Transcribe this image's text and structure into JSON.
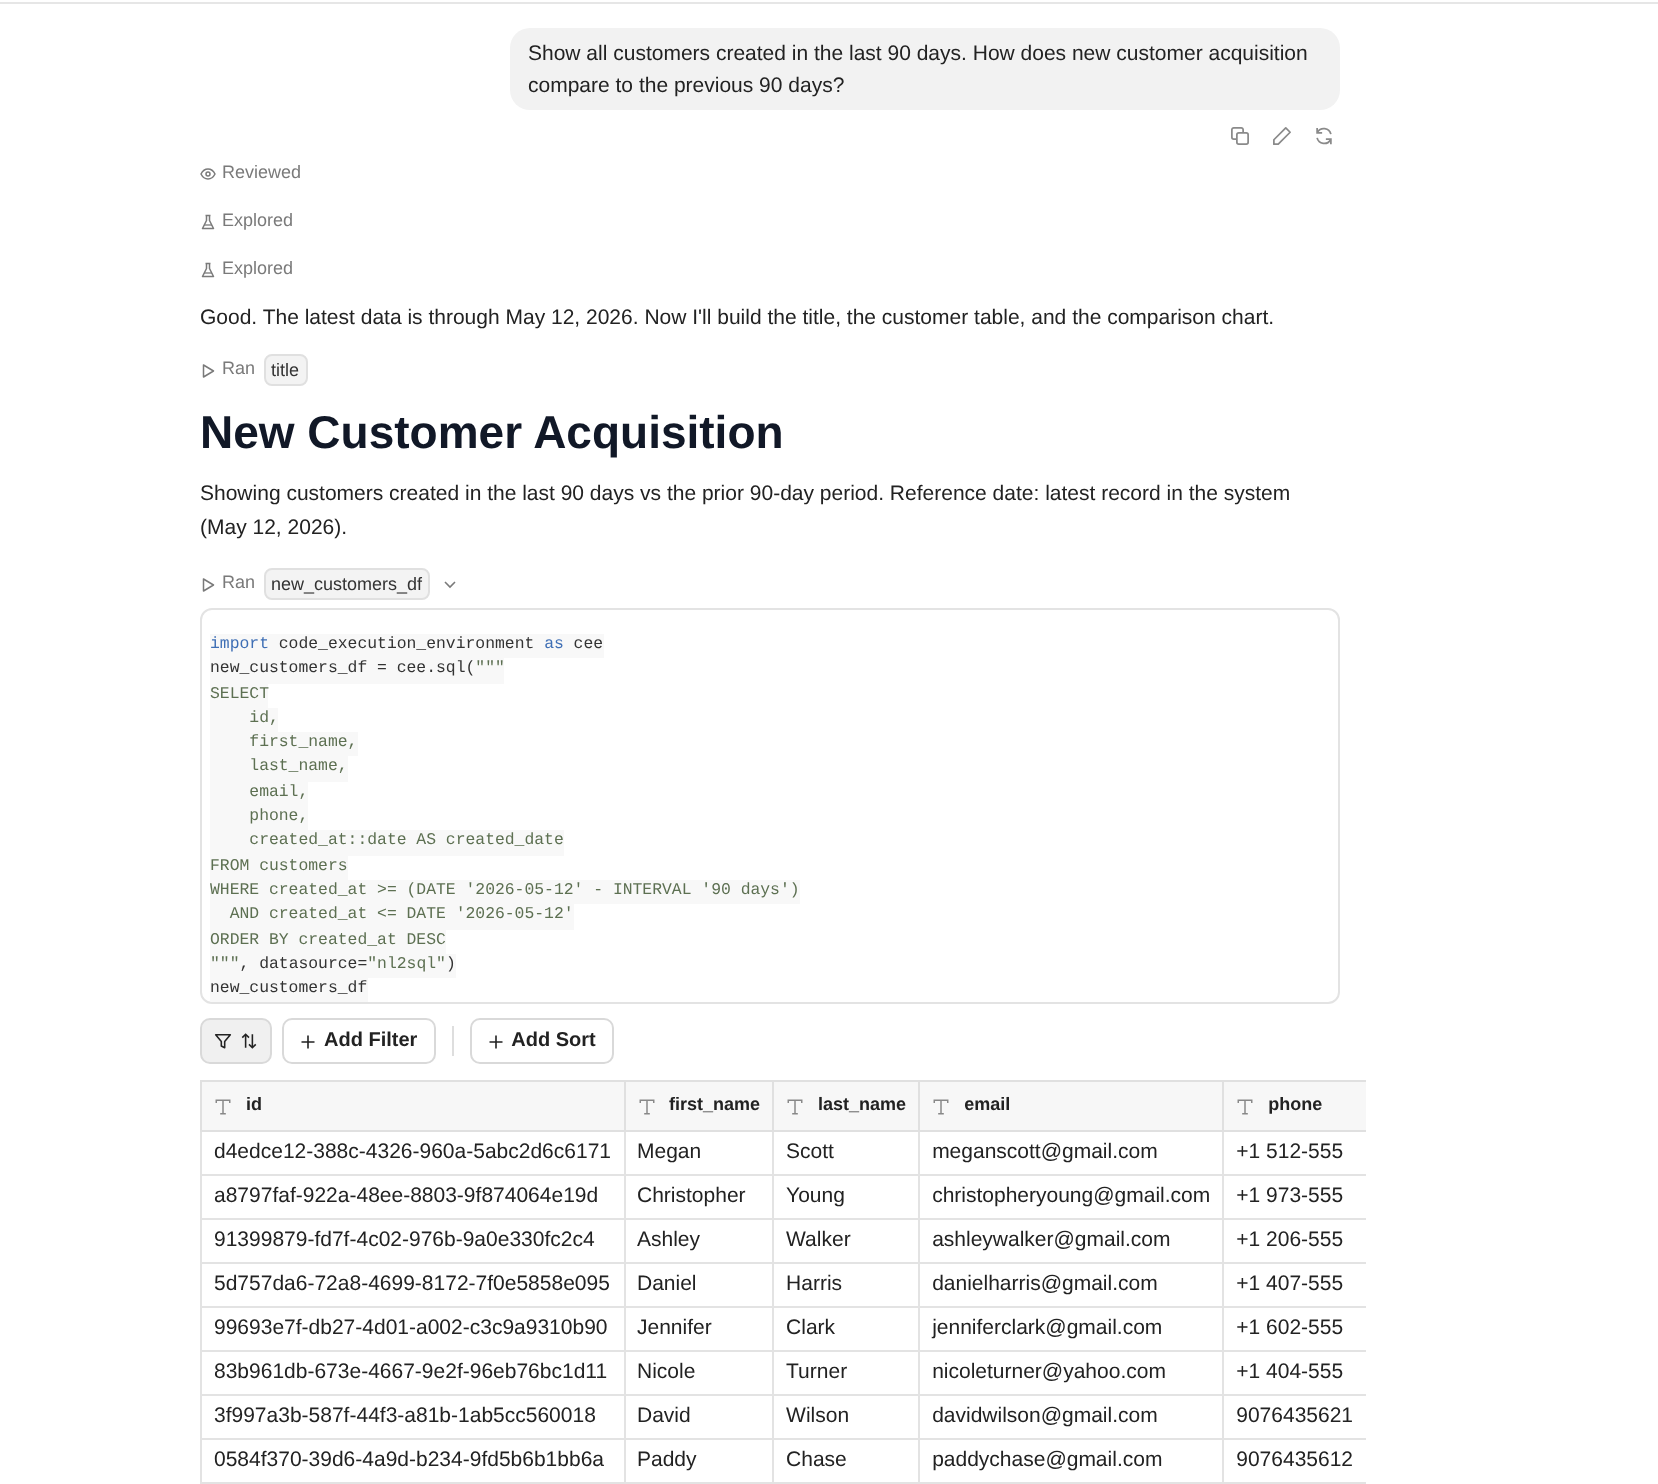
{
  "user_message": {
    "text": "Show all customers created in the last 90 days. How does new customer acquisition compare to the previous 90 days?"
  },
  "steps": [
    {
      "kind": "reviewed",
      "label": "Reviewed"
    },
    {
      "kind": "explored",
      "label": "Explored"
    },
    {
      "kind": "explored",
      "label": "Explored"
    }
  ],
  "assistant_message": "Good. The latest data is through May 12, 2026. Now I'll build the title, the customer table, and the comparison chart.",
  "run_title": {
    "label": "Ran",
    "chip": "title"
  },
  "title": "New Customer Acquisition",
  "description": "Showing customers created in the last 90 days vs the prior 90-day period. Reference date: latest record in the system (May 12, 2026).",
  "run_query": {
    "label": "Ran",
    "chip": "new_customers_df",
    "expanded": true,
    "code": [
      [
        {
          "kind": "keyword",
          "text": "import"
        },
        {
          "kind": "plain",
          "text": " code_execution_environment "
        },
        {
          "kind": "keyword",
          "text": "as"
        },
        {
          "kind": "plain",
          "text": " cee"
        }
      ],
      [
        {
          "kind": "plain",
          "text": "new_customers_df = cee.sql("
        },
        {
          "kind": "string",
          "text": "\"\"\""
        }
      ],
      [
        {
          "kind": "string",
          "text": "SELECT"
        }
      ],
      [
        {
          "kind": "string",
          "text": "    id,"
        }
      ],
      [
        {
          "kind": "string",
          "text": "    first_name,"
        }
      ],
      [
        {
          "kind": "string",
          "text": "    last_name,"
        }
      ],
      [
        {
          "kind": "string",
          "text": "    email,"
        }
      ],
      [
        {
          "kind": "string",
          "text": "    phone,"
        }
      ],
      [
        {
          "kind": "string",
          "text": "    created_at::date AS created_date"
        }
      ],
      [
        {
          "kind": "string",
          "text": "FROM customers"
        }
      ],
      [
        {
          "kind": "string",
          "text": "WHERE created_at >= (DATE '2026-05-12' - INTERVAL '90 days')"
        }
      ],
      [
        {
          "kind": "string",
          "text": "  AND created_at <= DATE '2026-05-12'"
        }
      ],
      [
        {
          "kind": "string",
          "text": "ORDER BY created_at DESC"
        }
      ],
      [
        {
          "kind": "string",
          "text": "\"\"\""
        },
        {
          "kind": "plain",
          "text": ", datasource="
        },
        {
          "kind": "string",
          "text": "\"nl2sql\""
        },
        {
          "kind": "plain",
          "text": ")"
        }
      ],
      [
        {
          "kind": "plain",
          "text": "new_customers_df"
        }
      ]
    ]
  },
  "table": {
    "toolbar": [
      {
        "kind": "filter_sort"
      },
      {
        "kind": "add",
        "label": "Add Filter"
      },
      {
        "kind": "add",
        "label": "Add Sort"
      }
    ],
    "columns": [
      {
        "kind": "text",
        "label": "id"
      },
      {
        "kind": "text",
        "label": "first_name"
      },
      {
        "kind": "text",
        "label": "last_name"
      },
      {
        "kind": "text",
        "label": "email"
      },
      {
        "kind": "text",
        "label": "phone"
      }
    ],
    "rows": [
      [
        "d4edce12-388c-4326-960a-5abc2d6c6171",
        "Megan",
        "Scott",
        "meganscott@gmail.com",
        "+1 512-555"
      ],
      [
        "a8797faf-922a-48ee-8803-9f874064e19d",
        "Christopher",
        "Young",
        "christopheryoung@gmail.com",
        "+1 973-555"
      ],
      [
        "91399879-fd7f-4c02-976b-9a0e330fc2c4",
        "Ashley",
        "Walker",
        "ashleywalker@gmail.com",
        "+1 206-555"
      ],
      [
        "5d757da6-72a8-4699-8172-7f0e5858e095",
        "Daniel",
        "Harris",
        "danielharris@gmail.com",
        "+1 407-555"
      ],
      [
        "99693e7f-db27-4d01-a002-c3c9a9310b90",
        "Jennifer",
        "Clark",
        "jenniferclark@gmail.com",
        "+1 602-555"
      ],
      [
        "83b961db-673e-4667-9e2f-96eb76bc1d11",
        "Nicole",
        "Turner",
        "nicoleturner@yahoo.com",
        "+1 404-555"
      ],
      [
        "3f997a3b-587f-44f3-a81b-1ab5cc560018",
        "David",
        "Wilson",
        "davidwilson@gmail.com",
        "9076435621"
      ],
      [
        "0584f370-39d6-4a9d-b234-9fd5b6b1bb6a",
        "Paddy",
        "Chase",
        "paddychase@gmail.com",
        "9076435612"
      ]
    ]
  }
}
